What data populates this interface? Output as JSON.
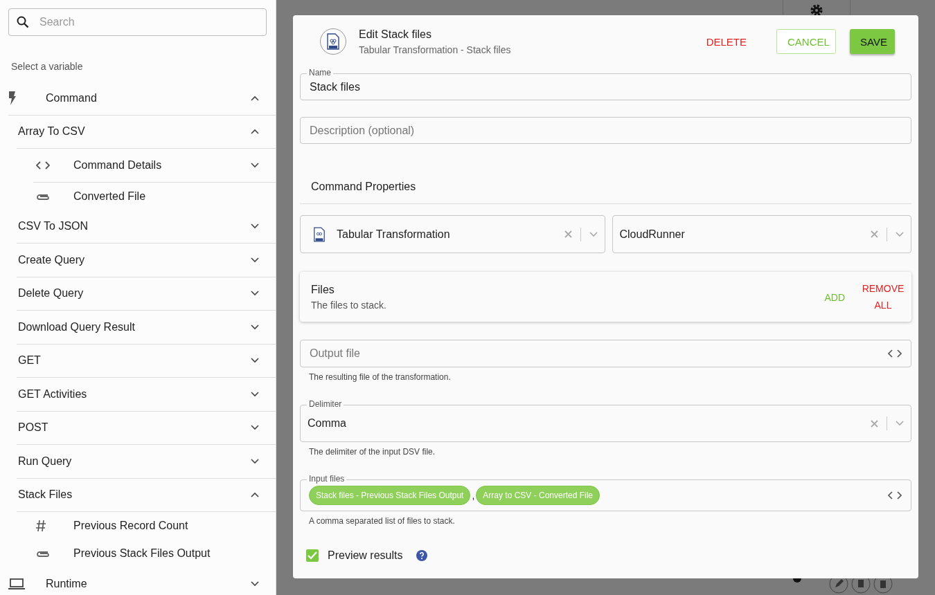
{
  "sidebar": {
    "search": {
      "placeholder": "Search"
    },
    "heading": "Select a variable",
    "tree": [
      {
        "label": "Command",
        "kind": "group",
        "expanded": true,
        "children": [
          {
            "label": "Array To CSV",
            "expanded": true,
            "children": [
              {
                "label": "Command Details",
                "kind": "details",
                "expanded": false
              },
              {
                "label": "Converted File",
                "kind": "file"
              }
            ]
          },
          {
            "label": "CSV To JSON",
            "expanded": false
          },
          {
            "label": "Create Query",
            "expanded": false
          },
          {
            "label": "Delete Query",
            "expanded": false
          },
          {
            "label": "Download Query Result",
            "expanded": false
          },
          {
            "label": "GET",
            "expanded": false
          },
          {
            "label": "GET Activities",
            "expanded": false
          },
          {
            "label": "POST",
            "expanded": false
          },
          {
            "label": "Run Query",
            "expanded": false
          },
          {
            "label": "Stack Files",
            "expanded": true,
            "children": [
              {
                "label": "Previous Record Count",
                "kind": "number"
              },
              {
                "label": "Previous Stack Files Output",
                "kind": "file"
              }
            ]
          }
        ]
      },
      {
        "label": "Runtime",
        "kind": "runtime",
        "expanded": false
      }
    ]
  },
  "modal": {
    "title": "Edit Stack files",
    "subtitle": "Tabular Transformation - Stack files",
    "actions": [
      {
        "label": "DELETE",
        "kind": "text"
      },
      {
        "label": "CANCEL",
        "kind": "outlined"
      },
      {
        "label": "SAVE",
        "kind": "filled"
      }
    ],
    "name_field": {
      "label": "Name",
      "value": "Stack files"
    },
    "description_field": {
      "placeholder": "Description (optional)"
    },
    "section_title": "Command Properties",
    "selects": [
      {
        "value": "Tabular Transformation",
        "kind": "with-icon"
      },
      {
        "value": "CloudRunner",
        "kind": "plain"
      }
    ],
    "files_card": {
      "title": "Files",
      "description": "The files to stack.",
      "add": "ADD",
      "remove": "REMOVE ALL"
    },
    "output_file": {
      "placeholder": "Output file",
      "helper": "The resulting file of the transformation."
    },
    "delimiter": {
      "label": "Delimiter",
      "value": "Comma",
      "helper": "The delimiter of the input DSV file."
    },
    "input_files": {
      "label": "Input files",
      "chips": [
        "Stack files - Previous Stack Files Output",
        "Array to CSV - Converted File"
      ],
      "separator": ",",
      "helper": "A comma separated list of files to stack."
    },
    "preview": {
      "label": "Preview results",
      "checked": true
    }
  }
}
